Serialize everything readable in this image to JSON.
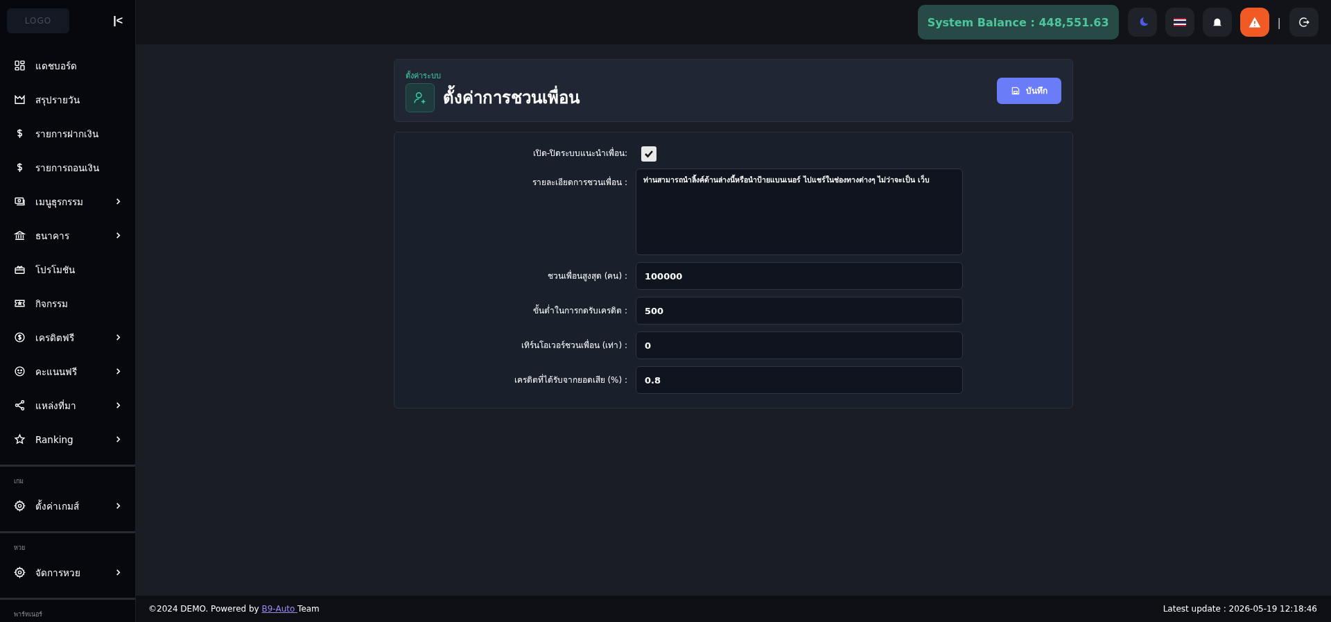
{
  "sidebar": {
    "logo": "LOGO",
    "collapse": "|<",
    "items": [
      {
        "label": "แดชบอร์ด",
        "has_submenu": false
      },
      {
        "label": "สรุปรายวัน",
        "has_submenu": false
      },
      {
        "label": "รายการฝากเงิน",
        "has_submenu": false
      },
      {
        "label": "รายการถอนเงิน",
        "has_submenu": false
      },
      {
        "label": "เมนูธุรกรรม",
        "has_submenu": true
      },
      {
        "label": "ธนาคาร",
        "has_submenu": true
      },
      {
        "label": "โปรโมชัน",
        "has_submenu": false
      },
      {
        "label": "กิจกรรม",
        "has_submenu": false
      },
      {
        "label": "เครดิตฟรี",
        "has_submenu": true
      },
      {
        "label": "คะแนนฟรี",
        "has_submenu": true
      },
      {
        "label": "แหล่งที่มา",
        "has_submenu": true
      },
      {
        "label": "Ranking",
        "has_submenu": true
      }
    ],
    "sections": [
      {
        "title": "เกม",
        "items": [
          {
            "label": "ตั้งค่าเกมส์",
            "has_submenu": true
          }
        ]
      },
      {
        "title": "หวย",
        "items": [
          {
            "label": "จัดการหวย",
            "has_submenu": true
          }
        ]
      },
      {
        "title": "พาร์ทเนอร์"
      }
    ]
  },
  "topbar": {
    "balance": "System Balance : 448,551.63",
    "separator": "|"
  },
  "header": {
    "breadcrumb": "ตั้งค่าระบบ",
    "title": "ตั้งค่าการชวนเพื่อน",
    "save_button": "บันทึก"
  },
  "form": {
    "fields": [
      {
        "kind": "checkbox",
        "label": "เปิด-ปิดระบบแนะนำเพื่อน:",
        "checked": true
      },
      {
        "kind": "textarea",
        "label": "รายละเอียดการชวนเพื่อน :",
        "value": "ท่านสามารถนำลิ้งค์ด้านล่างนี้หรือนำป้ายแบนเนอร์ ไปแชร์ในช่องทางต่างๆ ไม่ว่าจะเป็น เว็บ"
      },
      {
        "kind": "input",
        "label": "ชวนเพื่อนสูงสุด (คน) :",
        "value": "100000"
      },
      {
        "kind": "input",
        "label": "ขั้นต่ำในการกดรับเครดิต :",
        "value": "500"
      },
      {
        "kind": "input",
        "label": "เทิร์นโอเวอร์ชวนเพื่อน (เท่า) :",
        "value": "0"
      },
      {
        "kind": "input",
        "label": "เครดิตที่ได้รับจากยอดเสีย (%) :",
        "value": "0.8"
      }
    ]
  },
  "footer": {
    "copyright": "©2024 DEMO. Powered by",
    "link": "B9-Auto ",
    "team": "Team",
    "update": "Latest update : 2026-05-19 12:18:46"
  }
}
